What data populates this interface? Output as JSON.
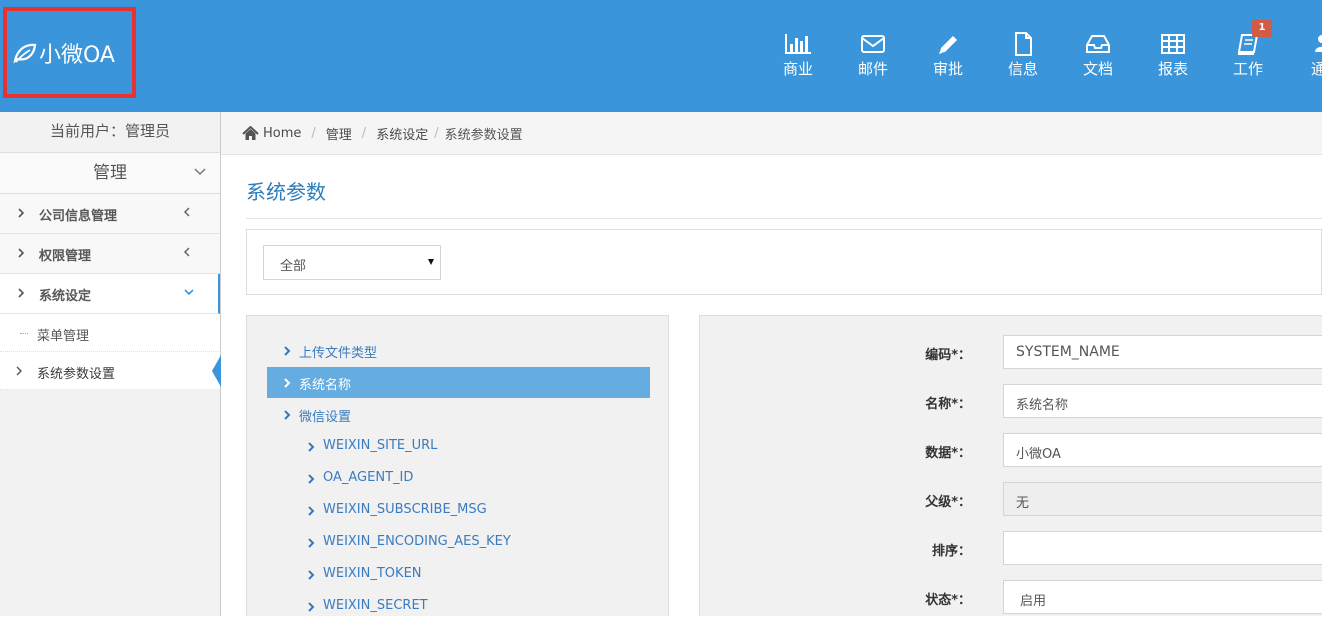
{
  "brand": {
    "name": "小微OA"
  },
  "nav": [
    {
      "label": "商业",
      "icon": "bar-chart-icon"
    },
    {
      "label": "邮件",
      "icon": "envelope-icon"
    },
    {
      "label": "审批",
      "icon": "pencil-icon"
    },
    {
      "label": "信息",
      "icon": "file-icon"
    },
    {
      "label": "文档",
      "icon": "inbox-icon"
    },
    {
      "label": "报表",
      "icon": "table-icon"
    },
    {
      "label": "工作",
      "icon": "book-icon",
      "badge": "1"
    },
    {
      "label": "通讯",
      "icon": "users-icon"
    }
  ],
  "sidebar": {
    "current_user": "当前用户：管理员",
    "section": "管理",
    "items": [
      {
        "label": "公司信息管理"
      },
      {
        "label": "权限管理"
      },
      {
        "label": "系统设定"
      }
    ],
    "subitems": [
      {
        "label": "菜单管理"
      },
      {
        "label": "系统参数设置"
      }
    ]
  },
  "breadcrumb": {
    "home": "Home",
    "items": [
      "管理",
      "系统设定",
      "系统参数设置"
    ]
  },
  "page": {
    "title": "系统参数"
  },
  "filter": {
    "selected": "全部"
  },
  "tree": [
    {
      "label": "上传文件类型"
    },
    {
      "label": "系统名称"
    },
    {
      "label": "微信设置"
    },
    {
      "label": "WEIXIN_SITE_URL"
    },
    {
      "label": "OA_AGENT_ID"
    },
    {
      "label": "WEIXIN_SUBSCRIBE_MSG"
    },
    {
      "label": "WEIXIN_ENCODING_AES_KEY"
    },
    {
      "label": "WEIXIN_TOKEN"
    },
    {
      "label": "WEIXIN_SECRET"
    }
  ],
  "form": {
    "fields": [
      {
        "label": "编码*：",
        "value": "SYSTEM_NAME"
      },
      {
        "label": "名称*：",
        "value": "系统名称"
      },
      {
        "label": "数据*：",
        "value": "小微OA"
      },
      {
        "label": "父级*：",
        "value": "无"
      },
      {
        "label": "排序：",
        "value": ""
      },
      {
        "label": "状态*：",
        "value": "启用"
      }
    ]
  },
  "colors": {
    "header": "#3a95da",
    "highlight": "#e83232",
    "tree_selected": "#65ace0",
    "badge": "#d15b47"
  }
}
